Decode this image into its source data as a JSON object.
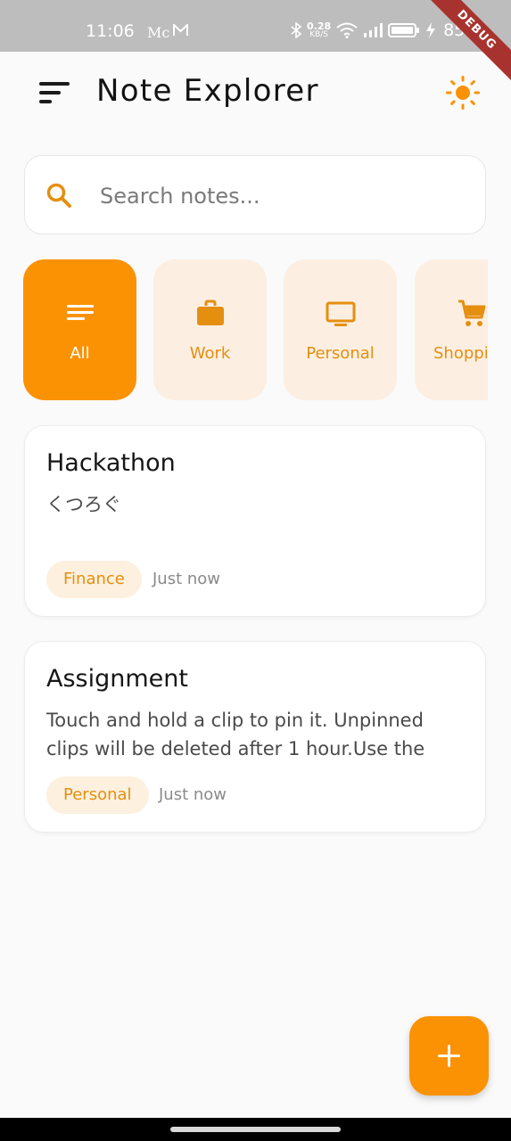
{
  "status_bar": {
    "time": "11:06",
    "carrier_label": "Mc",
    "net_speed_value": "0.28",
    "net_speed_unit": "KB/S",
    "battery": "85%",
    "debug_banner": "DEBUG"
  },
  "header": {
    "title": "Note Explorer"
  },
  "search": {
    "placeholder": "Search notes..."
  },
  "categories": [
    {
      "label": "All",
      "icon": "list-icon",
      "selected": true
    },
    {
      "label": "Work",
      "icon": "briefcase-icon",
      "selected": false
    },
    {
      "label": "Personal",
      "icon": "monitor-icon",
      "selected": false
    },
    {
      "label": "Shoppi",
      "icon": "cart-icon",
      "selected": false
    }
  ],
  "notes": [
    {
      "title": "Hackathon",
      "body": "くつろぐ",
      "tag": "Finance",
      "time": "Just now"
    },
    {
      "title": "Assignment",
      "body": "Touch and hold a clip to pin it. Unpinned clips will be deleted after 1 hour.Use the edit icon t...",
      "tag": "Personal",
      "time": "Just now"
    }
  ],
  "colors": {
    "accent": "#fb9204",
    "chip_bg": "#fcefe2",
    "background": "#fafafa"
  }
}
